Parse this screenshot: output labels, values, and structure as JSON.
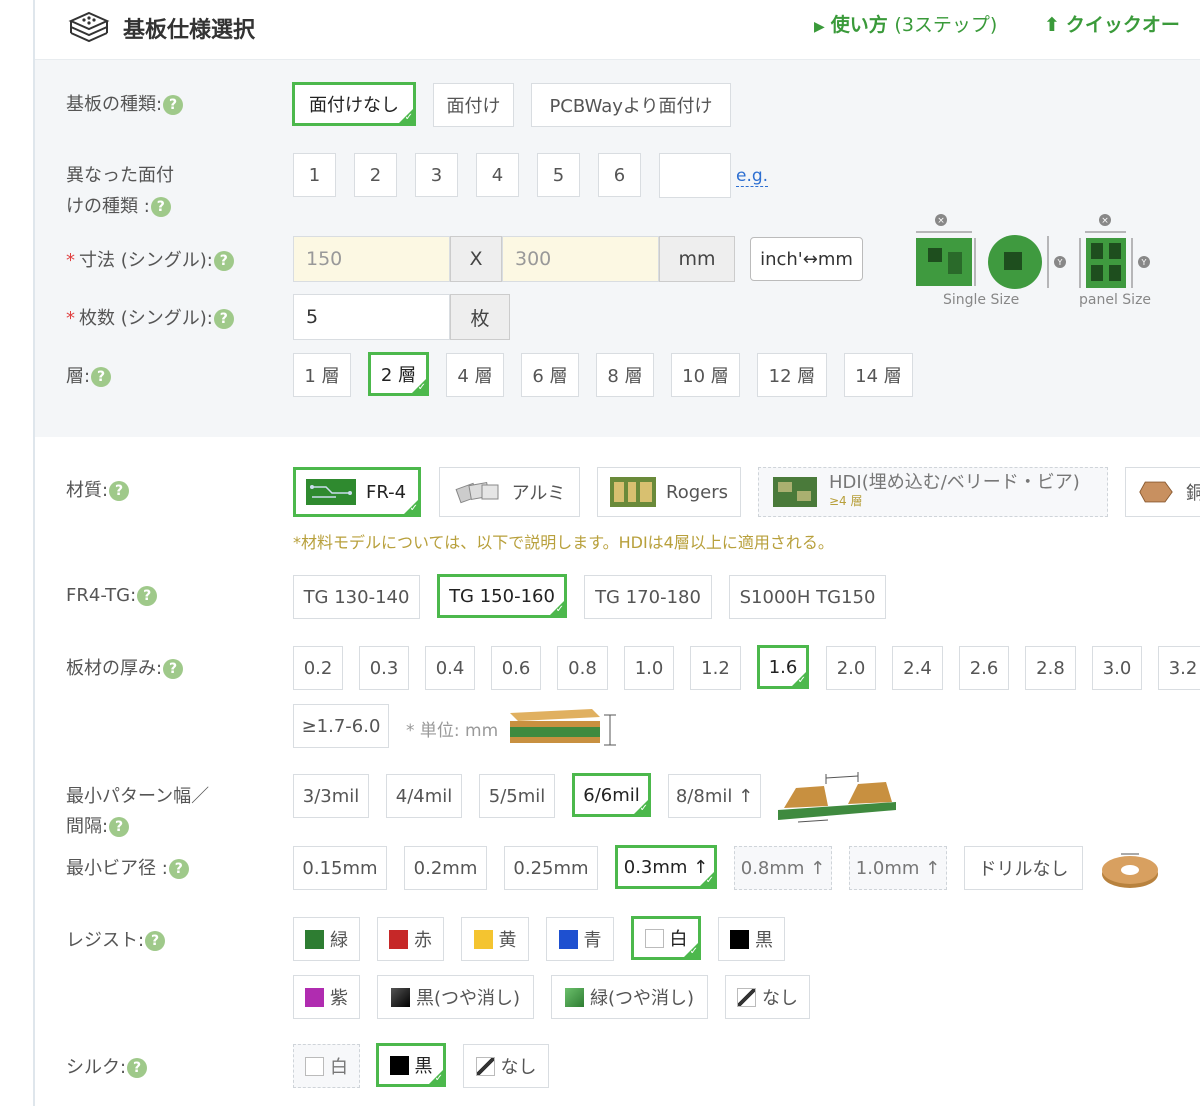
{
  "header": {
    "title": "基板仕様選択",
    "how_to": "使い方",
    "how_to_steps": "(3ステップ)",
    "quick_order": "クイックオー"
  },
  "board_type": {
    "label": "基板の種類:",
    "options": [
      "面付けなし",
      "面付け",
      "PCBWayより面付け"
    ],
    "selected": "面付けなし"
  },
  "panel_kinds": {
    "label_line1": "異なった面付",
    "label_line2": "けの種類 :",
    "options": [
      "1",
      "2",
      "3",
      "4",
      "5",
      "6"
    ],
    "custom_value": "",
    "eg_link": "e.g."
  },
  "size": {
    "label": "寸法 (シングル):",
    "width": "150",
    "x_label": "X",
    "height": "300",
    "unit": "mm",
    "convert_button": "inch'↔mm",
    "single_size_caption": "Single Size",
    "panel_size_caption": "panel Size"
  },
  "quantity": {
    "label": "枚数 (シングル):",
    "value": "5",
    "unit": "枚"
  },
  "layers": {
    "label": "層:",
    "options": [
      "1 層",
      "2 層",
      "4 層",
      "6 層",
      "8 層",
      "10 層",
      "12 層",
      "14 層"
    ],
    "selected": "2 層"
  },
  "material": {
    "label": "材質:",
    "options": [
      "FR-4",
      "アルミ",
      "Rogers",
      "HDI(埋め込む/ベリード・ビア)"
    ],
    "hdi_sub": "≥4 層",
    "cut_option_initial": "銅",
    "selected": "FR-4",
    "note": "*材料モデルについては、以下で説明します。HDIは4層以上に適用される。"
  },
  "fr4_tg": {
    "label": "FR4-TG:",
    "options": [
      "TG 130-140",
      "TG 150-160",
      "TG 170-180",
      "S1000H TG150"
    ],
    "selected": "TG 150-160"
  },
  "thickness": {
    "label": "板材の厚み:",
    "options": [
      "0.2",
      "0.3",
      "0.4",
      "0.6",
      "0.8",
      "1.0",
      "1.2",
      "1.6",
      "2.0",
      "2.4",
      "2.6",
      "2.8",
      "3.0",
      "3.2"
    ],
    "extra_option": "≥1.7-6.0",
    "unit_note": "* 単位: mm",
    "selected": "1.6"
  },
  "trace": {
    "label_line1": "最小パターン幅／",
    "label_line2": "間隔:",
    "options": [
      "3/3mil",
      "4/4mil",
      "5/5mil",
      "6/6mil",
      "8/8mil ↑"
    ],
    "selected": "6/6mil"
  },
  "via": {
    "label": "最小ビア径 :",
    "options": [
      "0.15mm",
      "0.2mm",
      "0.25mm",
      "0.3mm ↑",
      "0.8mm ↑",
      "1.0mm ↑",
      "ドリルなし"
    ],
    "selected": "0.3mm ↑"
  },
  "resist": {
    "label": "レジスト:",
    "row1": [
      "緑",
      "赤",
      "黄",
      "青",
      "白",
      "黒"
    ],
    "row2": [
      "紫",
      "黒(つや消し)",
      "緑(つや消し)",
      "なし"
    ],
    "selected": "白",
    "colors": {
      "green": "#2e7d32",
      "red": "#c62828",
      "yellow": "#f4c430",
      "blue": "#1e50d0",
      "white": "#ffffff",
      "black": "#000000",
      "purple": "#b02cb0"
    }
  },
  "silk": {
    "label": "シルク:",
    "options": [
      "白",
      "黒",
      "なし"
    ],
    "selected": "黒"
  },
  "help_icon": "?",
  "accent_color": "#4cb84c"
}
